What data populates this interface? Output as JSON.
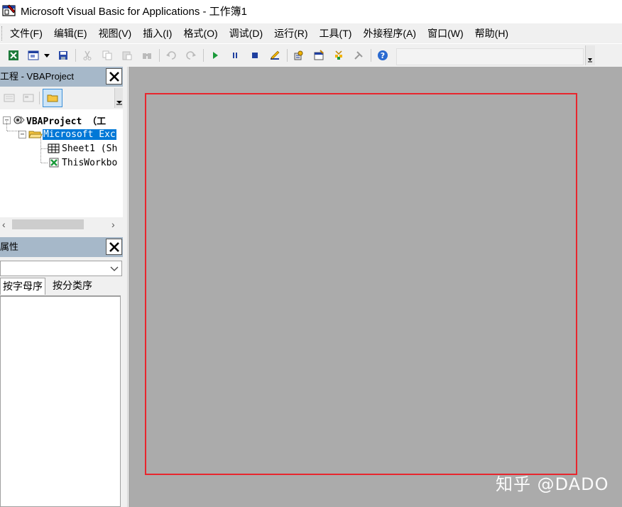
{
  "window": {
    "title": "Microsoft Visual Basic for Applications - 工作簿1"
  },
  "menubar": {
    "items": [
      "文件(F)",
      "编辑(E)",
      "视图(V)",
      "插入(I)",
      "格式(O)",
      "调试(D)",
      "运行(R)",
      "工具(T)",
      "外接程序(A)",
      "窗口(W)",
      "帮助(H)"
    ]
  },
  "project_pane": {
    "title": "工程 - VBAProject",
    "tree": {
      "root": "VBAProject （工",
      "folder": "Microsoft Exc",
      "sheet": "Sheet1 (Sh",
      "workbook": "ThisWorkbo"
    }
  },
  "properties_pane": {
    "title": "属性",
    "tabs": [
      "按字母序",
      "按分类序"
    ]
  },
  "watermark": "知乎 @DADO",
  "colors": {
    "mdi_background": "#ababab",
    "highlight": "#e8262d",
    "selection": "#0078d7",
    "pane_header": "#a6b8c9"
  }
}
